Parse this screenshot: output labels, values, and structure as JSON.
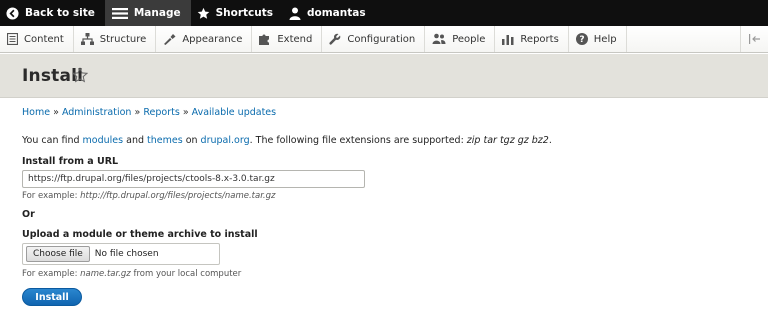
{
  "toolbar": {
    "back_label": "Back to site",
    "manage_label": "Manage",
    "shortcuts_label": "Shortcuts",
    "user_label": "domantas"
  },
  "tray": {
    "items": [
      {
        "label": "Content",
        "icon": "content-icon"
      },
      {
        "label": "Structure",
        "icon": "structure-icon"
      },
      {
        "label": "Appearance",
        "icon": "appearance-icon"
      },
      {
        "label": "Extend",
        "icon": "extend-icon"
      },
      {
        "label": "Configuration",
        "icon": "configuration-icon"
      },
      {
        "label": "People",
        "icon": "people-icon"
      },
      {
        "label": "Reports",
        "icon": "reports-icon"
      },
      {
        "label": "Help",
        "icon": "help-icon"
      }
    ],
    "collapse_icon": "collapse-tray-icon"
  },
  "page": {
    "title": "Install"
  },
  "breadcrumb": {
    "items": [
      "Home",
      "Administration",
      "Reports",
      "Available updates"
    ],
    "separator": "»"
  },
  "intro": {
    "prefix": "You can find ",
    "modules_link": "modules",
    "and": " and ",
    "themes_link": "themes",
    "on": " on ",
    "site_link": "drupal.org",
    "suffix": ". The following file extensions are supported: ",
    "extensions": "zip tar tgz gz bz2",
    "end": "."
  },
  "url_section": {
    "label": "Install from a URL",
    "value": "https://ftp.drupal.org/files/projects/ctools-8.x-3.0.tar.gz",
    "example_prefix": "For example: ",
    "example": "http://ftp.drupal.org/files/projects/name.tar.gz"
  },
  "or_label": "Or",
  "upload_section": {
    "label": "Upload a module or theme archive to install",
    "choose_button": "Choose file",
    "file_status": "No file chosen",
    "example_prefix": "For example: ",
    "example": "name.tar.gz",
    "example_suffix": " from your local computer"
  },
  "install_button": "Install",
  "colors": {
    "toolbar_bg": "#0f0f0f",
    "link": "#0a6bad",
    "primary_button": "#1065b0",
    "title_band": "#e3e2dc"
  }
}
